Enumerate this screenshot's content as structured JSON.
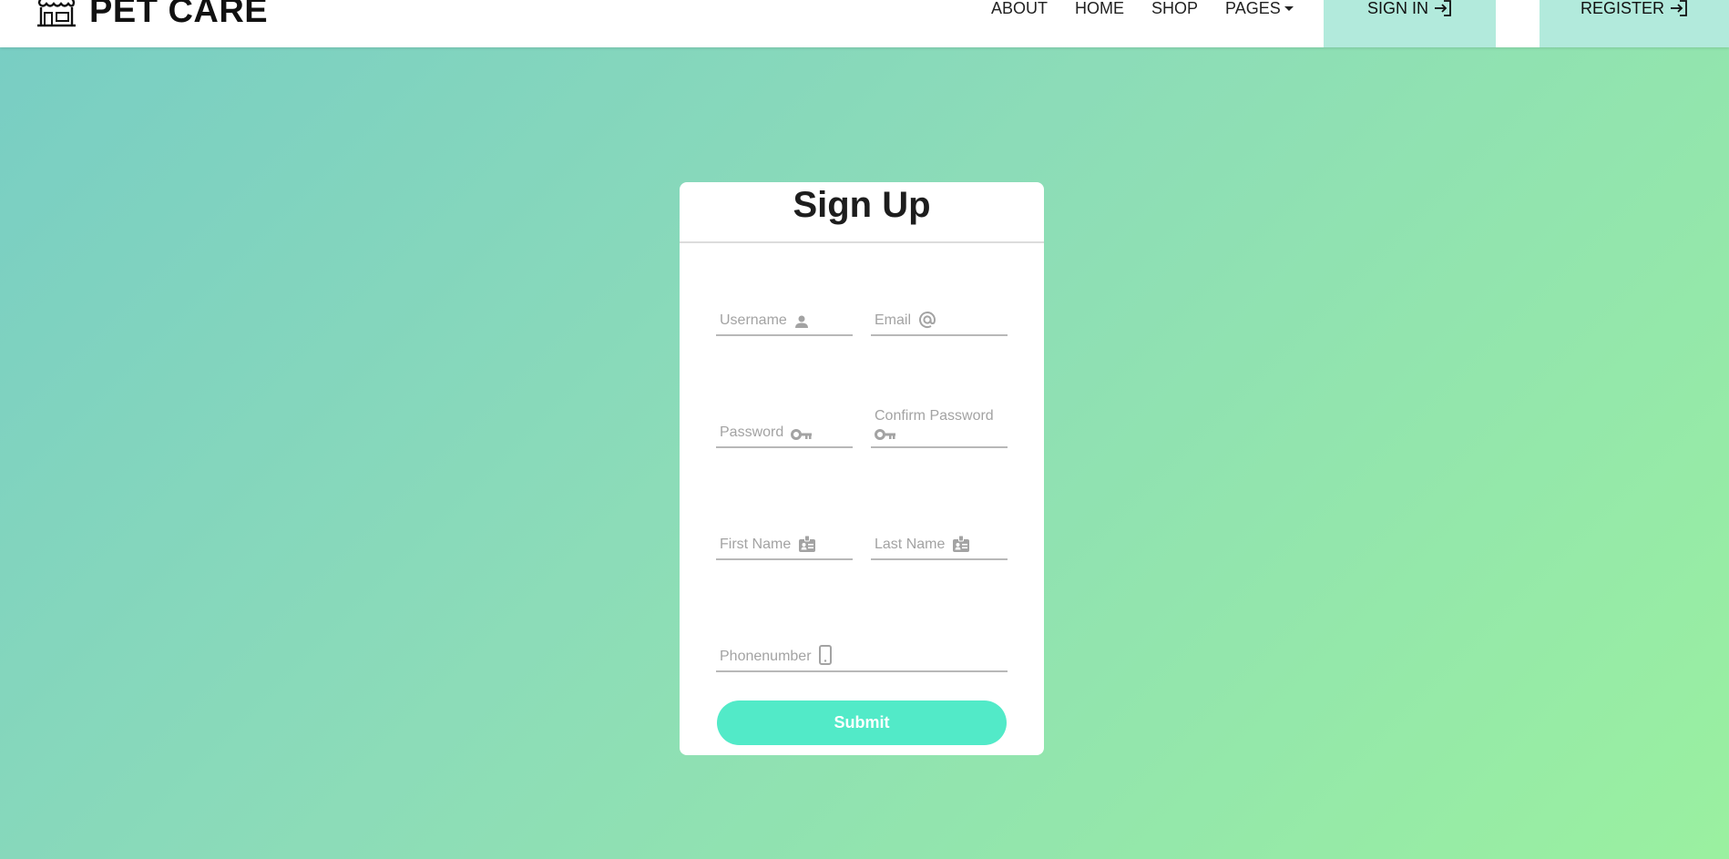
{
  "brand": {
    "name": "PET CARE",
    "icon": "storefront-icon"
  },
  "nav": {
    "links": [
      {
        "label": "ABOUT"
      },
      {
        "label": "HOME"
      },
      {
        "label": "SHOP"
      },
      {
        "label": "PAGES",
        "dropdown": true
      }
    ],
    "signin_label": "SIGN IN",
    "register_label": "REGISTER"
  },
  "form": {
    "title": "Sign Up",
    "username_placeholder": "Username",
    "email_placeholder": "Email",
    "password_placeholder": "Password",
    "confirm_password_placeholder": "Confirm Password",
    "first_name_placeholder": "First Name",
    "last_name_placeholder": "Last Name",
    "phone_placeholder": "Phonenumber",
    "submit_label": "Submit"
  },
  "colors": {
    "accent": "#52eac8",
    "nav_button_bg": "#b2eadc",
    "gradient_start": "#78cdc4",
    "gradient_end": "#9af0a0"
  }
}
